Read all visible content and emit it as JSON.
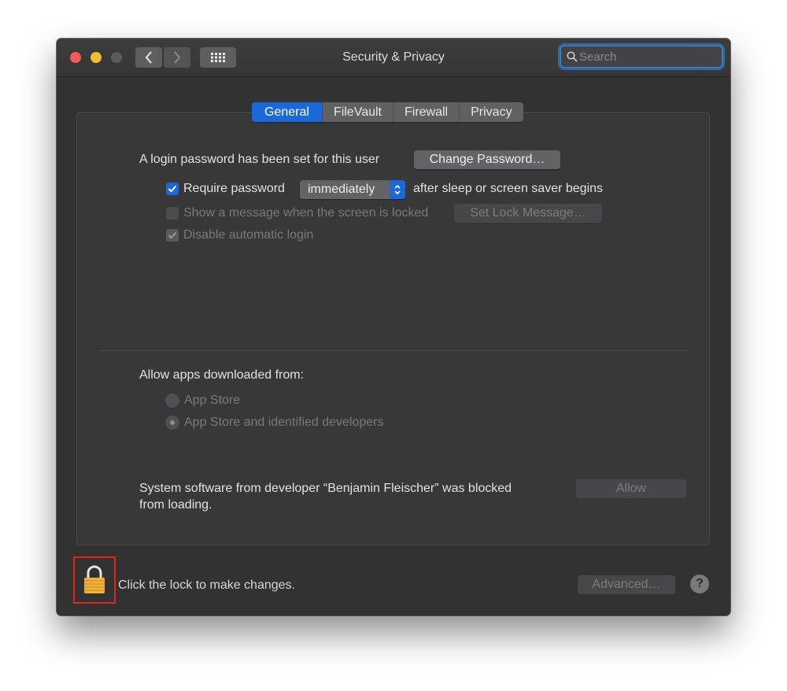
{
  "window": {
    "title": "Security & Privacy",
    "search": {
      "placeholder": "Search",
      "value": ""
    },
    "nav": {
      "back_icon": "chevron-left-icon",
      "forward_icon": "chevron-right-icon",
      "grid_icon": "grid-icon"
    }
  },
  "tabs": [
    {
      "label": "General",
      "active": true
    },
    {
      "label": "FileVault",
      "active": false
    },
    {
      "label": "Firewall",
      "active": false
    },
    {
      "label": "Privacy",
      "active": false
    }
  ],
  "general": {
    "login_text": "A login password has been set for this user",
    "change_password_label": "Change Password…",
    "require_password": {
      "label": "Require password",
      "checked": true,
      "select_value": "immediately",
      "suffix": "after sleep or screen saver begins"
    },
    "show_message": {
      "label": "Show a message when the screen is locked",
      "checked": false,
      "enabled": false,
      "button_label": "Set Lock Message…"
    },
    "disable_autologin": {
      "label": "Disable automatic login",
      "checked": true,
      "enabled": false
    },
    "allow_apps": {
      "heading": "Allow apps downloaded from:",
      "options": [
        {
          "label": "App Store",
          "selected": false
        },
        {
          "label": "App Store and identified developers",
          "selected": true
        }
      ]
    },
    "blocked": {
      "line1": "System software from developer “Benjamin Fleischer” was blocked",
      "line2": "from loading.",
      "allow_label": "Allow"
    }
  },
  "footer": {
    "lock_text": "Click the lock to make changes.",
    "advanced_label": "Advanced…",
    "help_label": "?"
  },
  "colors": {
    "accent": "#1b68d9",
    "highlight": "#e3261b",
    "lock": "#f2b33d"
  }
}
